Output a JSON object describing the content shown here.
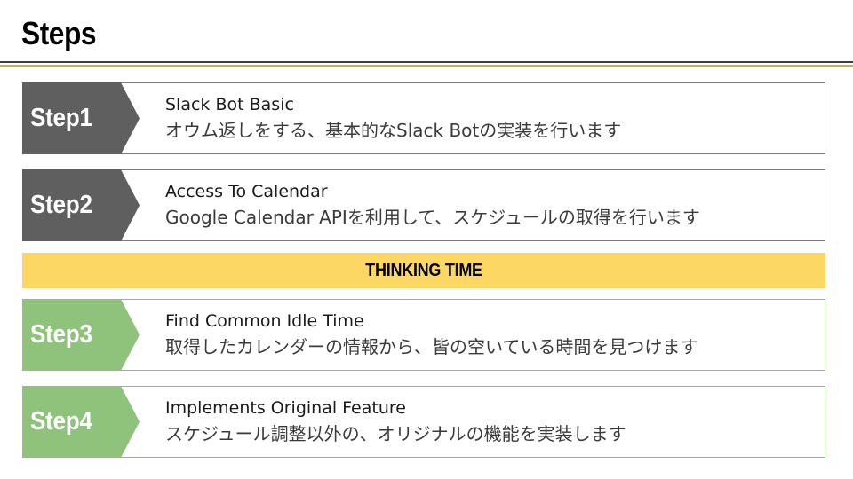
{
  "slide": {
    "title": "Steps"
  },
  "colors": {
    "step_gray": "#5f5f5f",
    "step_green": "#8fc27a",
    "thinking_bg": "#fcd764",
    "rule_dark": "#3f3f3f",
    "rule_gold": "#c8b04a"
  },
  "steps": [
    {
      "label": "Step1",
      "heading": "Slack Bot Basic",
      "description": "オウム返しをする、基本的なSlack Botの実装を行います"
    },
    {
      "label": "Step2",
      "heading": "Access To Calendar",
      "description": "Google Calendar APIを利用して、スケジュールの取得を行います"
    },
    {
      "label": "Step3",
      "heading": "Find Common Idle Time",
      "description": "取得したカレンダーの情報から、皆の空いている時間を見つけます"
    },
    {
      "label": "Step4",
      "heading": "Implements Original Feature",
      "description": "スケジュール調整以外の、オリジナルの機能を実装します"
    }
  ],
  "thinking": {
    "label": "THINKING TIME"
  }
}
